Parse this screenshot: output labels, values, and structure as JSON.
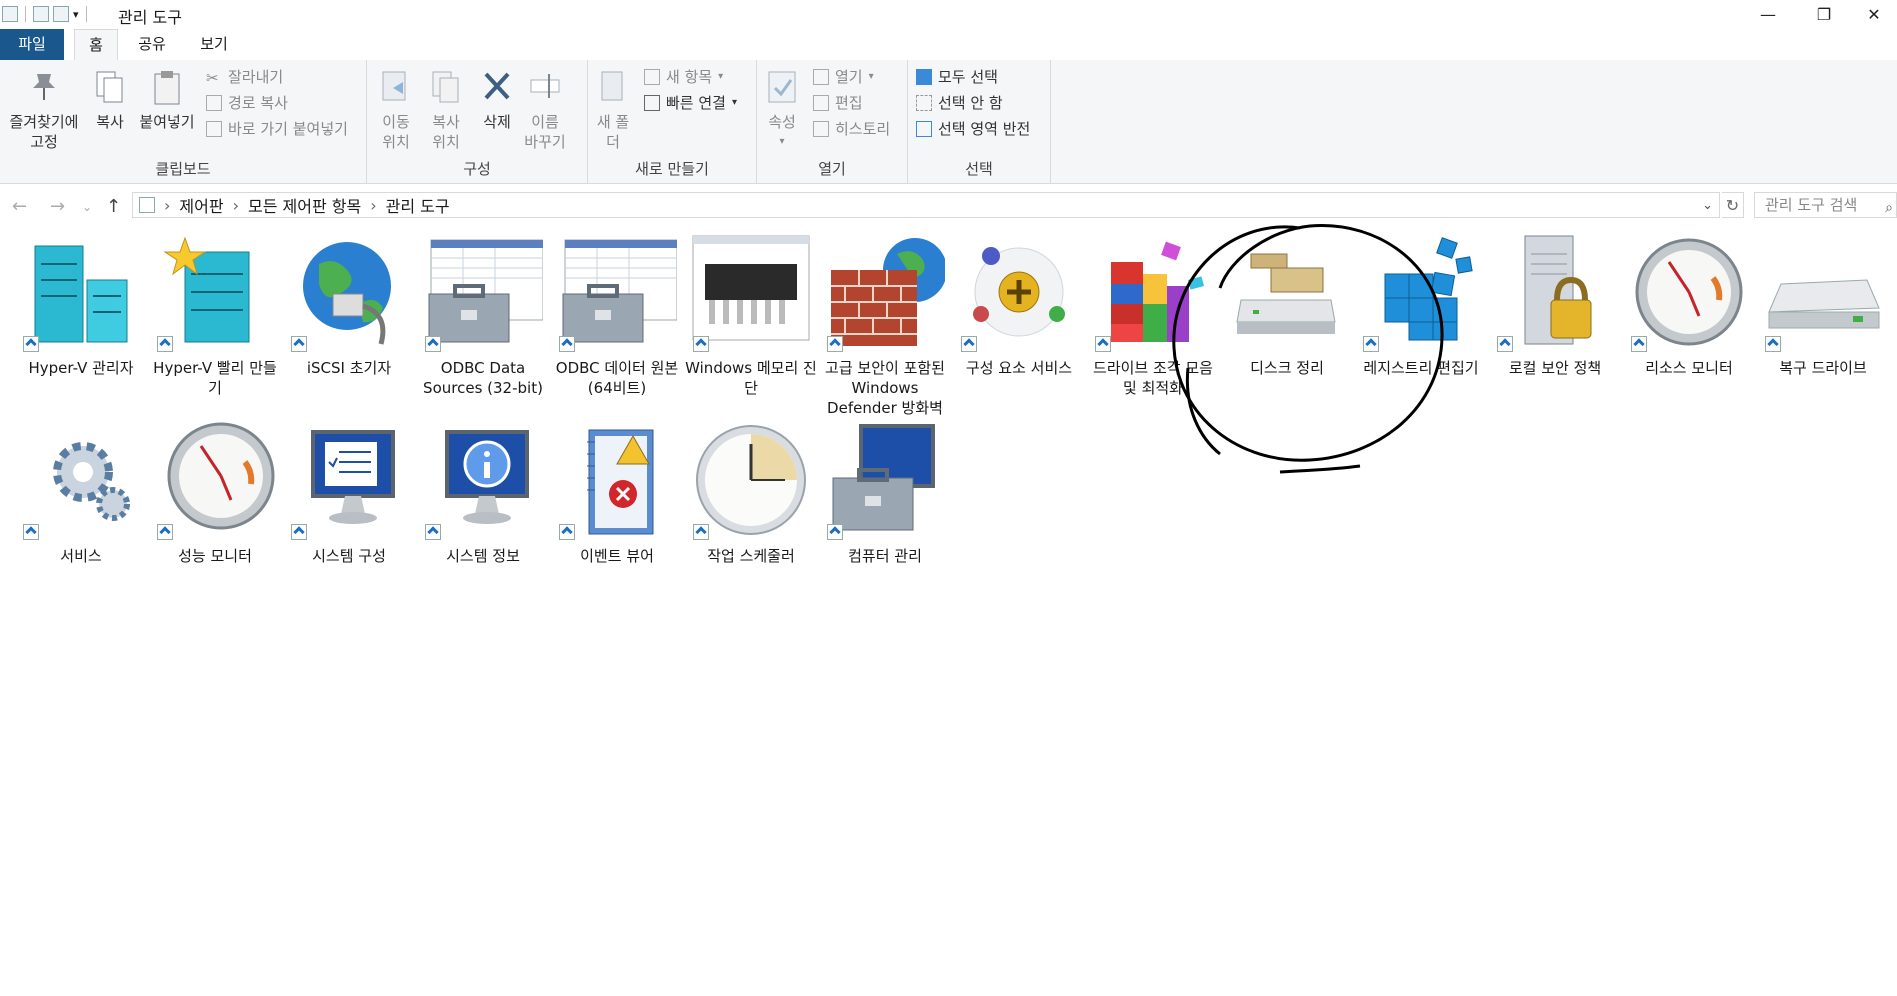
{
  "window": {
    "title": "관리 도구",
    "minimize_glyph": "—",
    "restore_glyph": "❐",
    "close_glyph": "✕"
  },
  "tabs": {
    "file": "파일",
    "home": "홈",
    "share": "공유",
    "view": "보기"
  },
  "ribbon": {
    "clipboard": {
      "label": "클립보드",
      "pin": "즐겨찾기에 고정",
      "copy": "복사",
      "paste": "붙여넣기",
      "cut": "잘라내기",
      "copy_path": "경로 복사",
      "paste_shortcut": "바로 가기 붙여넣기"
    },
    "organize": {
      "label": "구성",
      "move_to": "이동 위치",
      "copy_to": "복사 위치",
      "delete": "삭제",
      "rename": "이름 바꾸기"
    },
    "new": {
      "label": "새로 만들기",
      "new_folder": "새 폴더",
      "new_item": "새 항목",
      "easy_access": "빠른 연결"
    },
    "open": {
      "label": "열기",
      "properties": "속성",
      "open": "열기",
      "edit": "편집",
      "history": "히스토리"
    },
    "select": {
      "label": "선택",
      "select_all": "모두 선택",
      "select_none": "선택 안 함",
      "invert": "선택 영역 반전"
    }
  },
  "address": {
    "crumbs": [
      "제어판",
      "모든 제어판 항목",
      "관리 도구"
    ],
    "search_placeholder": "관리 도구 검색"
  },
  "items": [
    {
      "label": "Hyper-V 관리자",
      "icon": "server-icon"
    },
    {
      "label": "Hyper-V 빨리 만들기",
      "icon": "server-star-icon"
    },
    {
      "label": "iSCSI 초기자",
      "icon": "globe-cable-icon"
    },
    {
      "label": "ODBC Data Sources (32-bit)",
      "icon": "toolbox-grid-icon"
    },
    {
      "label": "ODBC 데이터 원본(64비트)",
      "icon": "toolbox-grid-icon"
    },
    {
      "label": "Windows 메모리 진단",
      "icon": "memory-chip-icon"
    },
    {
      "label": "고급 보안이 포함된 Windows Defender 방화벽",
      "icon": "firewall-icon"
    },
    {
      "label": "구성 요소 서비스",
      "icon": "component-icon"
    },
    {
      "label": "드라이브 조각 모음 및 최적화",
      "icon": "defrag-icon"
    },
    {
      "label": "디스크 정리",
      "icon": "disk-cleanup-icon"
    },
    {
      "label": "레지스트리 편집기",
      "icon": "registry-icon"
    },
    {
      "label": "로컬 보안 정책",
      "icon": "security-policy-icon"
    },
    {
      "label": "리소스 모니터",
      "icon": "gauge-icon"
    },
    {
      "label": "복구 드라이브",
      "icon": "drive-icon"
    },
    {
      "label": "서비스",
      "icon": "gears-icon"
    },
    {
      "label": "성능 모니터",
      "icon": "gauge-icon"
    },
    {
      "label": "시스템 구성",
      "icon": "monitor-checklist-icon"
    },
    {
      "label": "시스템 정보",
      "icon": "monitor-info-icon"
    },
    {
      "label": "이벤트 뷰어",
      "icon": "event-log-icon"
    },
    {
      "label": "작업 스케줄러",
      "icon": "clock-icon"
    },
    {
      "label": "컴퓨터 관리",
      "icon": "computer-toolbox-icon"
    }
  ]
}
